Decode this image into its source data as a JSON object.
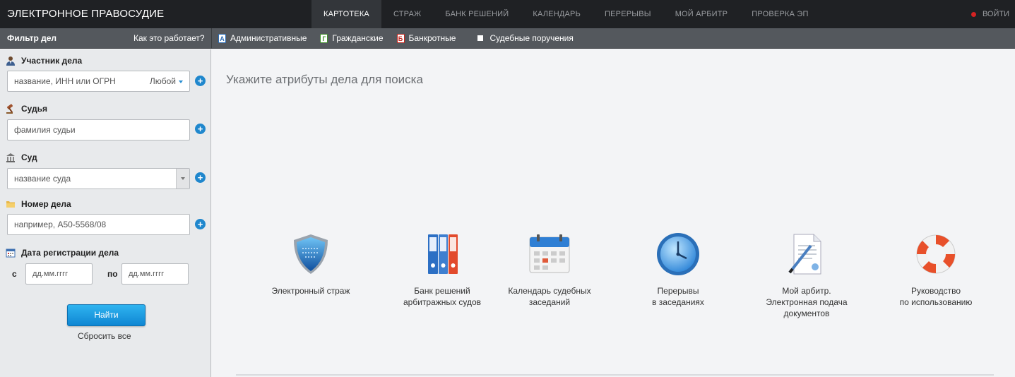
{
  "app": {
    "title": "ЭЛЕКТРОННОЕ ПРАВОСУДИЕ",
    "nav": [
      {
        "label": "КАРТОТЕКА",
        "active": true
      },
      {
        "label": "СТРАЖ",
        "active": false
      },
      {
        "label": "БАНК РЕШЕНИЙ",
        "active": false
      },
      {
        "label": "КАЛЕНДАРЬ",
        "active": false
      },
      {
        "label": "ПЕРЕРЫВЫ",
        "active": false
      },
      {
        "label": "МОЙ АРБИТР",
        "active": false
      },
      {
        "label": "ПРОВЕРКА ЭП",
        "active": false
      }
    ],
    "login_label": "ВОЙТИ",
    "login_dot_color": "#d42323"
  },
  "subbar": {
    "filter_title": "Фильтр дел",
    "how_link": "Как это работает?",
    "case_types": [
      {
        "badge": "А",
        "label": "Административные",
        "color": "#2b6cb5"
      },
      {
        "badge": "Г",
        "label": "Гражданские",
        "color": "#3f8f2b"
      },
      {
        "badge": "Б",
        "label": "Банкротные",
        "color": "#c3271f"
      }
    ],
    "court_orders_label": "Судебные поручения"
  },
  "sidebar": {
    "participant": {
      "label": "Участник дела",
      "placeholder": "название, ИНН или ОГРН",
      "mode": "Любой",
      "icon": "person-icon"
    },
    "judge": {
      "label": "Судья",
      "placeholder": "фамилия судьи",
      "icon": "gavel-icon"
    },
    "court": {
      "label": "Суд",
      "placeholder": "название суда",
      "icon": "courthouse-icon"
    },
    "case_number": {
      "label": "Номер дела",
      "placeholder": "например, А50-5568/08",
      "icon": "folder-icon"
    },
    "reg_date": {
      "label": "Дата регистрации дела",
      "from_label": "с",
      "to_label": "по",
      "from_placeholder": "дд.мм.гггг",
      "to_placeholder": "дд.мм.гггг",
      "icon": "calendar-icon"
    },
    "find_button": "Найти",
    "reset_link": "Сбросить все"
  },
  "main": {
    "heading": "Укажите атрибуты дела для поиска",
    "tiles": [
      {
        "name": "electronic-guard",
        "lines": [
          "Электронный страж"
        ],
        "icon": "shield-icon"
      },
      {
        "name": "decision-bank",
        "lines": [
          "Банк решений",
          "арбитражных судов"
        ],
        "icon": "binders-icon"
      },
      {
        "name": "court-calendar",
        "lines": [
          "Календарь судебных",
          "заседаний"
        ],
        "icon": "calendar-icon"
      },
      {
        "name": "breaks",
        "lines": [
          "Перерывы",
          "в заседаниях"
        ],
        "icon": "clock-icon"
      },
      {
        "name": "my-arbiter",
        "lines": [
          "Мой арбитр.",
          "Электронная подача",
          "документов"
        ],
        "icon": "document-pen-icon"
      },
      {
        "name": "manual",
        "lines": [
          "Руководство",
          "по использованию"
        ],
        "icon": "lifebuoy-icon"
      }
    ]
  }
}
